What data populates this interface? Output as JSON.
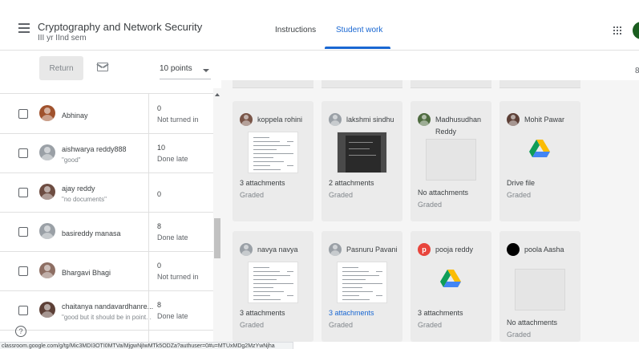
{
  "header": {
    "class_title": "Cryptography and Network Security",
    "class_subtitle": "III yr IInd sem",
    "tabs": [
      {
        "label": "Instructions",
        "active": false
      },
      {
        "label": "Student work",
        "active": true
      }
    ]
  },
  "toolbar": {
    "return_label": "Return",
    "points_value": "10 points",
    "right_edge_icon": "8"
  },
  "colors": {
    "accent": "#1967d2",
    "background_grid": "#f5f5f5",
    "card": "#ebebeb"
  },
  "roster": [
    {
      "name": "Abhinay",
      "comment": "",
      "grade": "0",
      "status": "Not turned in",
      "avatar_color": "#a0522d"
    },
    {
      "name": "aishwarya reddy888",
      "comment": "\"good\"",
      "grade": "10",
      "status": "Done late",
      "avatar_color": "#9aa0a6"
    },
    {
      "name": "ajay reddy",
      "comment": "\"no documents\"",
      "grade": "0",
      "status": "",
      "avatar_color": "#6d4c41"
    },
    {
      "name": "basireddy manasa",
      "comment": "",
      "grade": "8",
      "status": "Done late",
      "avatar_color": "#9aa0a6"
    },
    {
      "name": "Bhargavi Bhagi",
      "comment": "",
      "grade": "0",
      "status": "Not turned in",
      "avatar_color": "#8d6e63"
    },
    {
      "name": "chaitanya nandavardhanre...",
      "comment": "\"good but it should be in point...",
      "grade": "8",
      "status": "Done late",
      "avatar_color": "#5d4037"
    }
  ],
  "cards": [
    {
      "name": "koppela rohini",
      "line1": "3 attachments",
      "line2": "Graded",
      "thumb": "doc",
      "avatar_color": "#795548"
    },
    {
      "name": "lakshmi sindhu",
      "line1": "2 attachments",
      "line2": "Graded",
      "thumb": "photo",
      "avatar_color": "#9aa0a6"
    },
    {
      "name": "Madhusudhan Reddy",
      "line1": "No attachments",
      "line2": "Graded",
      "thumb": "empty",
      "avatar_color": "#4e6b3f"
    },
    {
      "name": "Mohit Pawar",
      "line1": "Drive file",
      "line2": "Graded",
      "thumb": "drive",
      "avatar_color": "#5d4037"
    },
    {
      "name": "navya navya",
      "line1": "3 attachments",
      "line2": "Graded",
      "thumb": "doc",
      "avatar_color": "#9aa0a6"
    },
    {
      "name": "Pasnuru Pavani",
      "line1": "3 attachments",
      "line2": "Graded",
      "thumb": "doc",
      "avatar_color": "#9aa0a6"
    },
    {
      "name": "pooja reddy",
      "line1": "3 attachments",
      "line2": "Graded",
      "thumb": "drive",
      "avatar_color": "#e8453c",
      "avatar_letter": "p"
    },
    {
      "name": "poola Aasha",
      "line1": "No attachments",
      "line2": "Graded",
      "thumb": "empty",
      "avatar_color": "#000000"
    }
  ],
  "icons": {
    "menu": "hamburger-icon",
    "apps": "apps-grid-icon",
    "mail": "email-icon",
    "help": "help-icon",
    "drive": "google-drive-icon"
  },
  "help_label": "?",
  "status_url": "classroom.google.com/g/tg/Mic3MDI3OTI0MTVa/MjgwNjIwMTk5ODZa?authuser=0#u=MTUxMDg2MzYwNjha"
}
